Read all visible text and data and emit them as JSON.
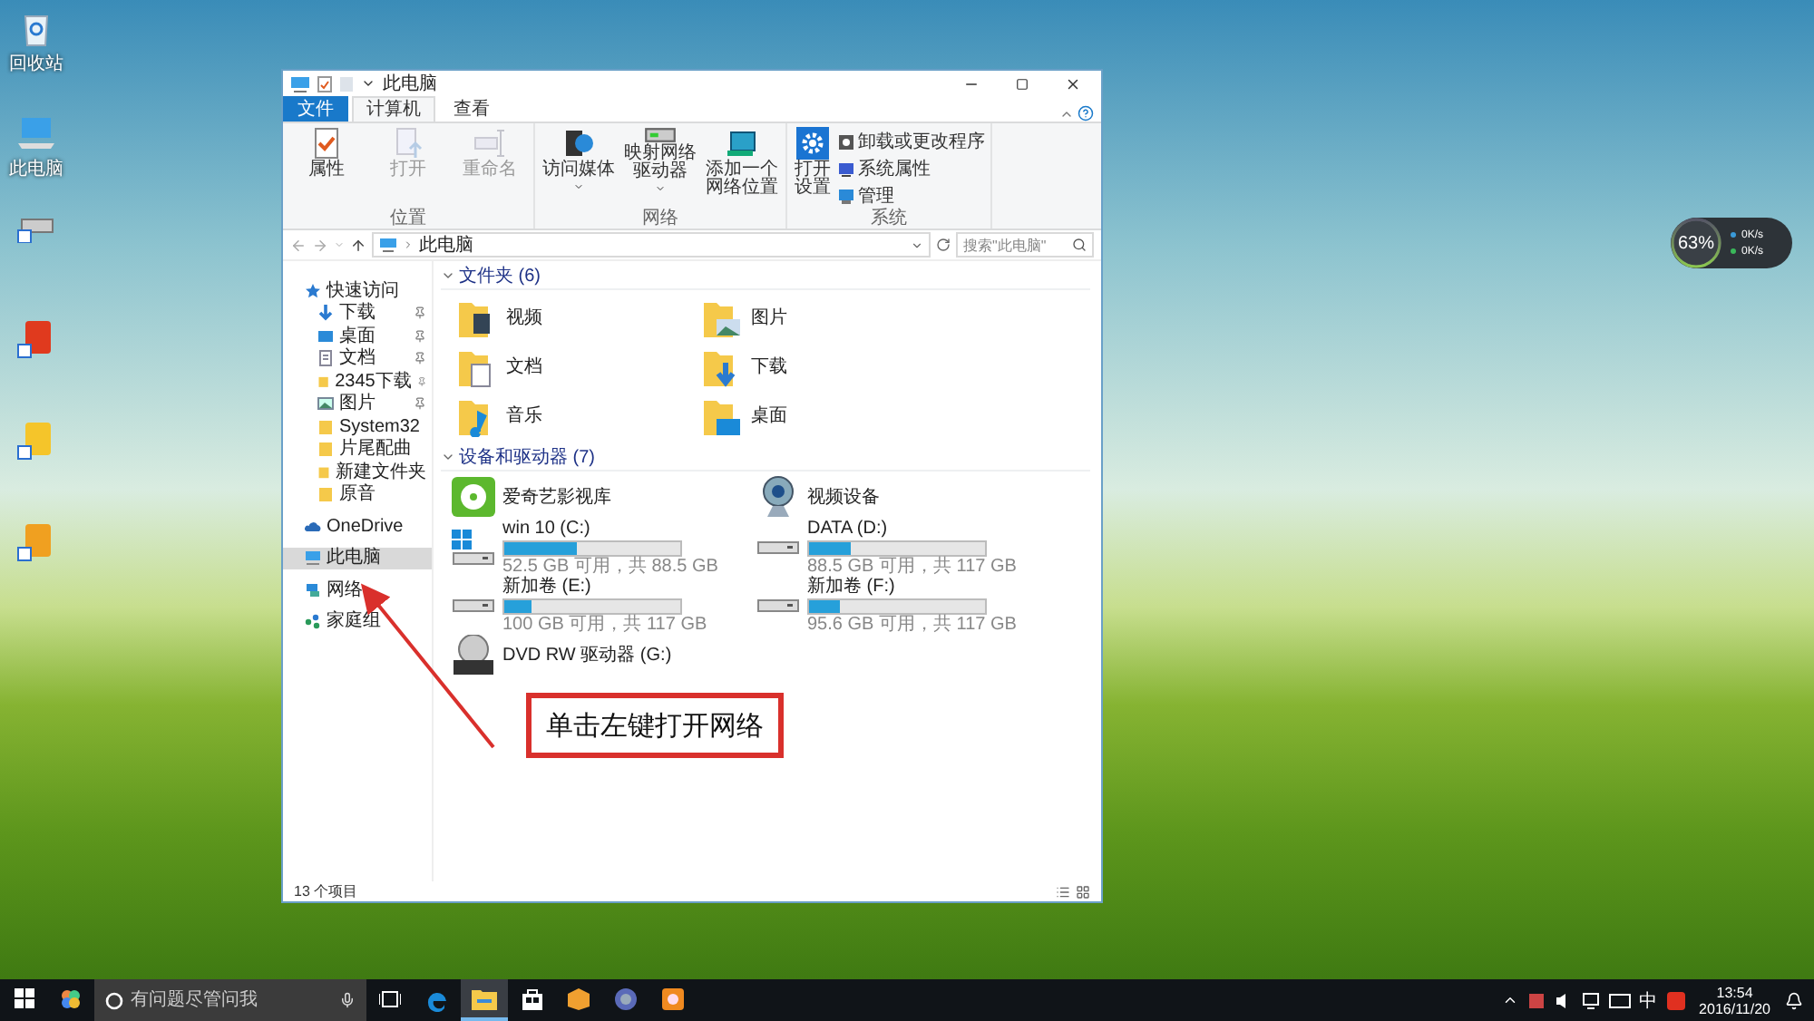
{
  "desktop_icons": [
    {
      "kind": "recycle",
      "label": "回收站"
    },
    {
      "kind": "pc",
      "label": "此电脑"
    },
    {
      "kind": "drive"
    },
    {
      "kind": "red_app"
    },
    {
      "kind": "yellow_app"
    },
    {
      "kind": "orange_app"
    }
  ],
  "window": {
    "title": "此电脑",
    "tabs": [
      {
        "label": "文件",
        "kind": "file",
        "selected": false
      },
      {
        "label": "计算机",
        "kind": "tab",
        "selected": true
      },
      {
        "label": "查看",
        "kind": "tab",
        "selected": false
      }
    ],
    "ribbon": [
      {
        "label": "位置",
        "buttons": [
          {
            "label": "属性",
            "disabled": false
          },
          {
            "label": "打开",
            "disabled": true
          },
          {
            "label": "重命名",
            "disabled": true
          }
        ]
      },
      {
        "label": "网络",
        "buttons": [
          {
            "label": "访问媒体",
            "disabled": false,
            "dropdown": true
          },
          {
            "label": "映射网络驱动器",
            "disabled": false,
            "dropdown": true
          },
          {
            "label": "添加一个网络位置",
            "disabled": false,
            "dropdown": false
          }
        ]
      },
      {
        "label": "系统",
        "buttons": [
          {
            "label": "打开设置",
            "disabled": false
          }
        ],
        "links": [
          {
            "label": "卸载或更改程序"
          },
          {
            "label": "系统属性"
          },
          {
            "label": "管理"
          }
        ]
      }
    ],
    "address": {
      "path": "此电脑",
      "search_placeholder": "搜索\"此电脑\""
    },
    "nav": [
      {
        "label": "快速访问",
        "kind": "star",
        "selected": false,
        "children": [
          {
            "label": "下载",
            "kind": "download",
            "pinned": true,
            "selected": false
          },
          {
            "label": "桌面",
            "kind": "desktop",
            "pinned": true,
            "selected": false
          },
          {
            "label": "文档",
            "kind": "document",
            "pinned": true,
            "selected": false
          },
          {
            "label": "2345下载",
            "kind": "folder",
            "pinned": true,
            "selected": false
          },
          {
            "label": "图片",
            "kind": "pictures",
            "pinned": true,
            "selected": false
          },
          {
            "label": "System32",
            "kind": "folder",
            "pinned": false,
            "selected": false
          },
          {
            "label": "片尾配曲",
            "kind": "folder",
            "pinned": false,
            "selected": false
          },
          {
            "label": "新建文件夹",
            "kind": "folder",
            "pinned": false,
            "selected": false
          },
          {
            "label": "原音",
            "kind": "folder",
            "pinned": false,
            "selected": false
          }
        ]
      },
      {
        "label": "OneDrive",
        "kind": "cloud",
        "selected": false
      },
      {
        "label": "此电脑",
        "kind": "pc",
        "selected": true
      },
      {
        "label": "网络",
        "kind": "network",
        "selected": false
      },
      {
        "label": "家庭组",
        "kind": "homegroup",
        "selected": false
      }
    ],
    "folders_header": "文件夹 (6)",
    "folders": [
      {
        "label": "视频",
        "kind": "video"
      },
      {
        "label": "图片",
        "kind": "pictures"
      },
      {
        "label": "文档",
        "kind": "documents"
      },
      {
        "label": "下载",
        "kind": "downloads"
      },
      {
        "label": "音乐",
        "kind": "music"
      },
      {
        "label": "桌面",
        "kind": "desktop"
      }
    ],
    "devices_header": "设备和驱动器 (7)",
    "devices": [
      {
        "kind": "app",
        "name": "爱奇艺影视库"
      },
      {
        "kind": "camera",
        "name": "视频设备"
      },
      {
        "kind": "drive",
        "name": "win 10 (C:)",
        "system": true,
        "level": 0.41,
        "caption": "52.5 GB 可用，共 88.5 GB"
      },
      {
        "kind": "drive",
        "name": "DATA (D:)",
        "system": false,
        "level": 0.24,
        "caption": "88.5 GB 可用，共 117 GB"
      },
      {
        "kind": "drive",
        "name": "新加卷 (E:)",
        "system": false,
        "level": 0.15,
        "caption": "100 GB 可用，共 117 GB"
      },
      {
        "kind": "drive",
        "name": "新加卷 (F:)",
        "system": false,
        "level": 0.18,
        "caption": "95.6 GB 可用，共 117 GB"
      },
      {
        "kind": "dvd",
        "name": "DVD RW 驱动器 (G:)"
      }
    ],
    "status": "13 个项目"
  },
  "annotation": "单击左键打开网络",
  "widget": {
    "percent": "63%",
    "upload": "0K/s",
    "download": "0K/s"
  },
  "taskbar": {
    "search_placeholder": "有问题尽管问我",
    "apps": [
      {
        "kind": "taskview",
        "selected": false
      },
      {
        "kind": "edge",
        "selected": false
      },
      {
        "kind": "explorer",
        "selected": true
      },
      {
        "kind": "store",
        "selected": false
      },
      {
        "kind": "box",
        "selected": false
      },
      {
        "kind": "globe",
        "selected": false
      },
      {
        "kind": "game",
        "selected": false
      }
    ],
    "ime": "中",
    "time": "13:54",
    "date": "2016/11/20"
  }
}
